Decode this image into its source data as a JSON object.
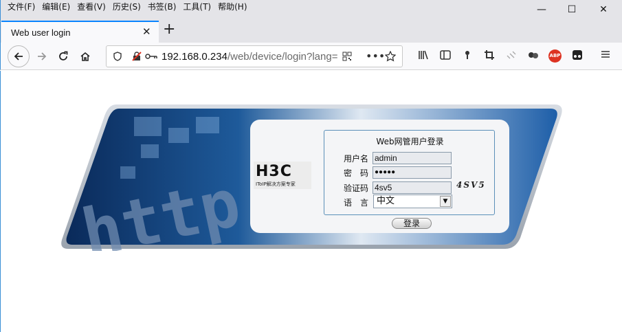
{
  "menu": [
    "文件(F)",
    "编辑(E)",
    "查看(V)",
    "历史(S)",
    "书签(B)",
    "工具(T)",
    "帮助(H)"
  ],
  "window_controls": {
    "minimize": "—",
    "maximize": "☐",
    "close": "✕"
  },
  "tab": {
    "title": "Web user login",
    "close": "✕",
    "new_tab": "+"
  },
  "address": {
    "host": "192.168.0.234",
    "path": "/web/device/login?lang="
  },
  "login": {
    "title": "Web网管用户登录",
    "username_label": "用户名",
    "username_value": "admin",
    "password_label": "密　码",
    "password_value": "●●●●●",
    "captcha_label": "验证码",
    "captcha_value": "4sv5",
    "captcha_image_text": "4SV5",
    "language_label": "语　言",
    "language_value": "中文",
    "submit_label": "登录"
  },
  "logo": {
    "main": "H3C",
    "sub": "IToIP解决方案专家"
  },
  "banner": {
    "text": "http://www"
  }
}
